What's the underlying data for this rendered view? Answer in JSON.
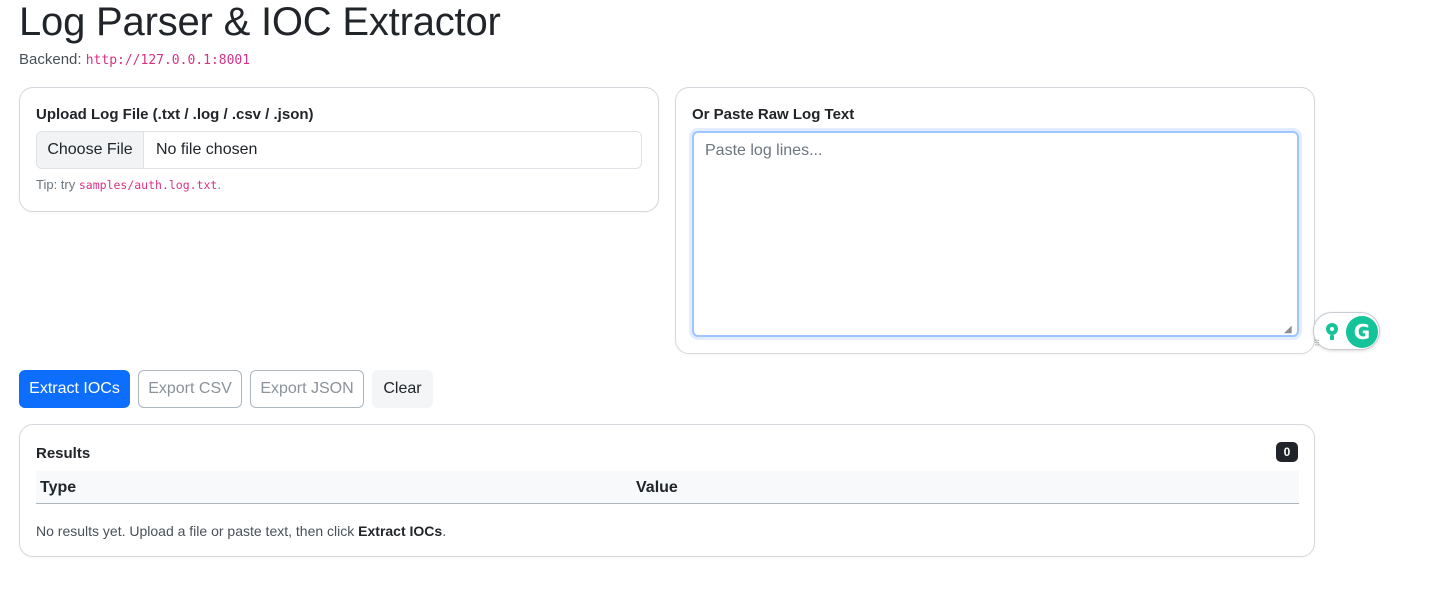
{
  "page": {
    "title": "Log Parser & IOC Extractor",
    "backend_label": "Backend:",
    "backend_url": "http://127.0.0.1:8001"
  },
  "upload": {
    "label": "Upload Log File (.txt / .log / .csv / .json)",
    "choose_file_button": "Choose File",
    "file_status": "No file chosen",
    "tip_prefix": "Tip: try",
    "tip_sample": "samples/auth.log.txt",
    "tip_suffix": "."
  },
  "paste": {
    "label": "Or Paste Raw Log Text",
    "placeholder": "Paste log lines..."
  },
  "actions": {
    "extract_label": "Extract IOCs",
    "export_csv_label": "Export CSV",
    "export_json_label": "Export JSON",
    "clear_label": "Clear"
  },
  "results": {
    "title": "Results",
    "count": "0",
    "columns": [
      "Type",
      "Value"
    ],
    "empty_prefix": "No results yet. Upload a file or paste text, then click",
    "empty_action": "Extract IOCs",
    "empty_suffix": "."
  },
  "extension": {
    "icon": "grammarly-icon",
    "letter": "G",
    "accent": "#15c39a"
  },
  "colors": {
    "primary": "#0d6efd",
    "code": "#d63384",
    "badge": "#212529"
  }
}
